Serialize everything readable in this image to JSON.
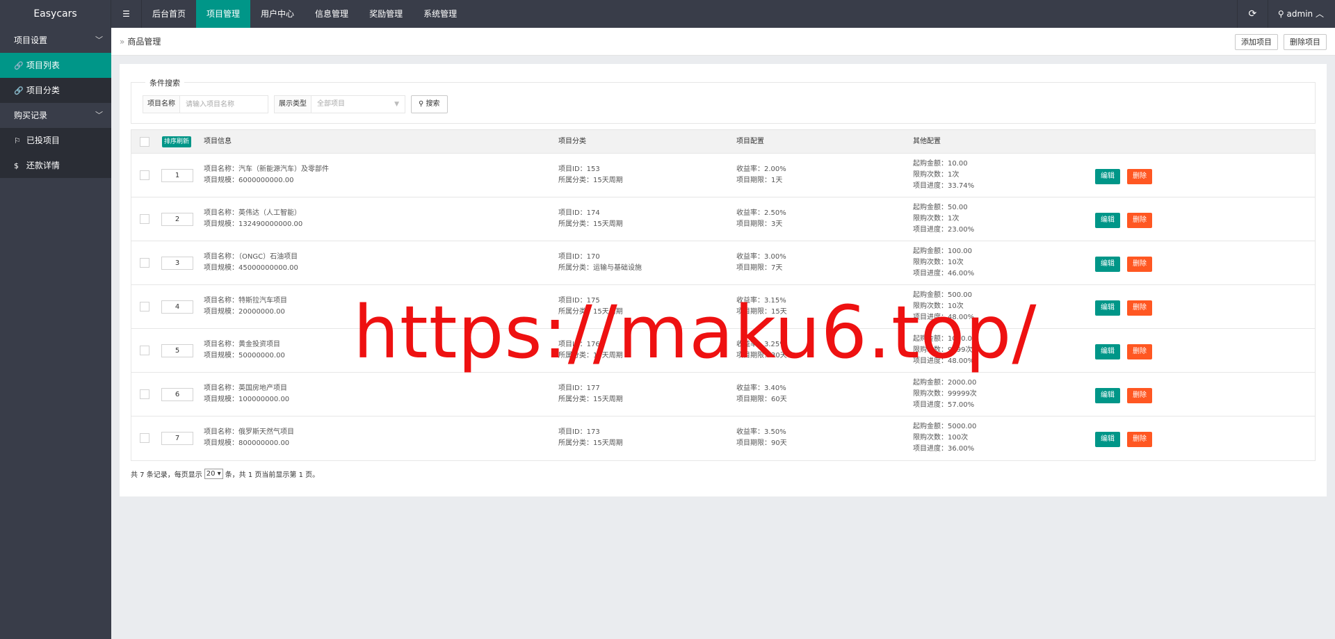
{
  "app": {
    "title": "Easycars"
  },
  "topnav": {
    "toggle_glyph": "☰",
    "items": [
      {
        "label": "后台首页",
        "active": false
      },
      {
        "label": "项目管理",
        "active": true
      },
      {
        "label": "用户中心",
        "active": false
      },
      {
        "label": "信息管理",
        "active": false
      },
      {
        "label": "奖励管理",
        "active": false
      },
      {
        "label": "系统管理",
        "active": false
      }
    ],
    "user": "admin"
  },
  "sidebar": {
    "group1": "项目设置",
    "item1": "项目列表",
    "item2": "项目分类",
    "group2": "购买记录",
    "item3": "已投项目",
    "item4": "还款详情"
  },
  "breadcrumb": {
    "current": "商品管理"
  },
  "actions": {
    "add": "添加项目",
    "delete": "删除项目"
  },
  "search": {
    "legend": "条件搜索",
    "name_label": "项目名称",
    "name_placeholder": "请输入项目名称",
    "type_label": "展示类型",
    "type_value": "全部项目",
    "button": "搜索"
  },
  "table": {
    "sort_button": "排序刷新",
    "headers": {
      "info": "项目信息",
      "category": "项目分类",
      "config": "项目配置",
      "other": "其他配置"
    },
    "edit_label": "编辑",
    "delete_label": "删除",
    "rows": [
      {
        "sort": "1",
        "name": "项目名称：汽车（新能源汽车）及零部件",
        "scale": "项目规模：6000000000.00",
        "id": "项目ID：153",
        "cat": "所属分类：15天周期",
        "rate": "收益率：2.00%",
        "term": "项目期限：1天",
        "min": "起购金额：10.00",
        "limit": "限购次数：1次",
        "progress": "项目进度：33.74%"
      },
      {
        "sort": "2",
        "name": "项目名称：英伟达（人工智能）",
        "scale": "项目规模：132490000000.00",
        "id": "项目ID：174",
        "cat": "所属分类：15天周期",
        "rate": "收益率：2.50%",
        "term": "项目期限：3天",
        "min": "起购金额：50.00",
        "limit": "限购次数：1次",
        "progress": "项目进度：23.00%"
      },
      {
        "sort": "3",
        "name": "项目名称：（ONGC）石油项目",
        "scale": "项目规模：45000000000.00",
        "id": "项目ID：170",
        "cat": "所属分类：运输与基础设施",
        "rate": "收益率：3.00%",
        "term": "项目期限：7天",
        "min": "起购金额：100.00",
        "limit": "限购次数：10次",
        "progress": "项目进度：46.00%"
      },
      {
        "sort": "4",
        "name": "项目名称：特斯拉汽车项目",
        "scale": "项目规模：20000000.00",
        "id": "项目ID：175",
        "cat": "所属分类：15天周期",
        "rate": "收益率：3.15%",
        "term": "项目期限：15天",
        "min": "起购金额：500.00",
        "limit": "限购次数：10次",
        "progress": "项目进度：48.00%"
      },
      {
        "sort": "5",
        "name": "项目名称：黄金投资项目",
        "scale": "项目规模：50000000.00",
        "id": "项目ID：176",
        "cat": "所属分类：15天周期",
        "rate": "收益率：3.25%",
        "term": "项目期限：30天",
        "min": "起购金额：1000.00",
        "limit": "限购次数：9999次",
        "progress": "项目进度：48.00%"
      },
      {
        "sort": "6",
        "name": "项目名称：英国房地产项目",
        "scale": "项目规模：100000000.00",
        "id": "项目ID：177",
        "cat": "所属分类：15天周期",
        "rate": "收益率：3.40%",
        "term": "项目期限：60天",
        "min": "起购金额：2000.00",
        "limit": "限购次数：99999次",
        "progress": "项目进度：57.00%"
      },
      {
        "sort": "7",
        "name": "项目名称：俄罗斯天然气项目",
        "scale": "项目规模：800000000.00",
        "id": "项目ID：173",
        "cat": "所属分类：15天周期",
        "rate": "收益率：3.50%",
        "term": "项目期限：90天",
        "min": "起购金额：5000.00",
        "limit": "限购次数：100次",
        "progress": "项目进度：36.00%"
      }
    ]
  },
  "pager": {
    "prefix": "共 7 条记录，每页显示",
    "page_size": "20",
    "suffix": "条，共 1 页当前显示第 1 页。"
  },
  "watermark": "https://maku6.top/",
  "colors": {
    "primary": "#009688",
    "danger": "#ff5722",
    "dark": "#393d49"
  }
}
